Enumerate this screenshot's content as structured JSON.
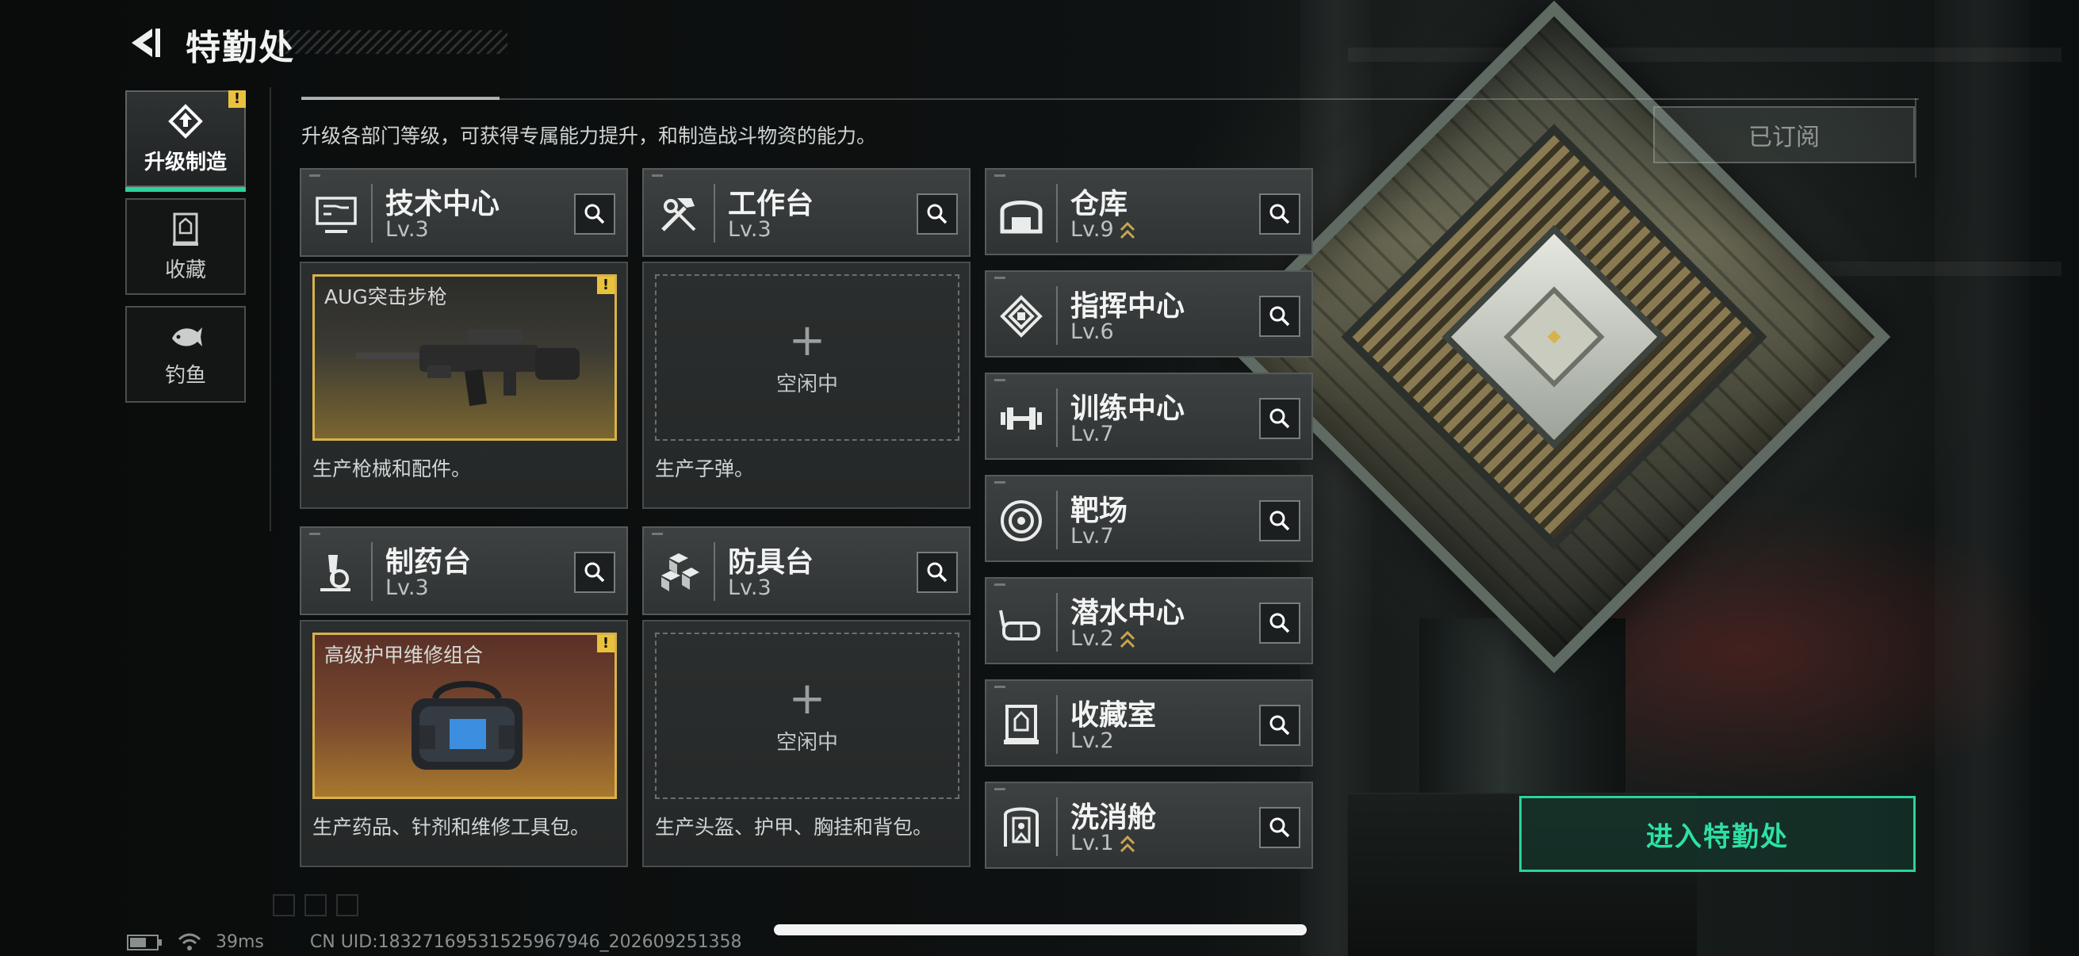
{
  "header": {
    "title": "特勤处"
  },
  "nav": [
    {
      "label": "升级制造",
      "icon": "upgrade-icon",
      "active": true,
      "badge": "!"
    },
    {
      "label": "收藏",
      "icon": "collection-icon",
      "active": false
    },
    {
      "label": "钓鱼",
      "icon": "fish-icon",
      "active": false
    }
  ],
  "description": "升级各部门等级，可获得专属能力提升，和制造战斗物资的能力。",
  "subscribed_label": "已订阅",
  "production_departments": [
    {
      "name": "技术中心",
      "level": "Lv.3",
      "icon": "monitor-icon",
      "slot": {
        "state": "producing",
        "item": "AUG突击步枪",
        "badge": "!"
      },
      "desc": "生产枪械和配件。"
    },
    {
      "name": "工作台",
      "level": "Lv.3",
      "icon": "hammer-wrench-icon",
      "slot": {
        "state": "idle",
        "idle_label": "空闲中"
      },
      "desc": "生产子弹。"
    },
    {
      "name": "制药台",
      "level": "Lv.3",
      "icon": "microscope-icon",
      "slot": {
        "state": "producing",
        "item": "高级护甲维修组合",
        "badge": "!"
      },
      "desc": "生产药品、针剂和维修工具包。"
    },
    {
      "name": "防具台",
      "level": "Lv.3",
      "icon": "blocks-icon",
      "slot": {
        "state": "idle",
        "idle_label": "空闲中"
      },
      "desc": "生产头盔、护甲、胸挂和背包。"
    }
  ],
  "other_departments": [
    {
      "name": "仓库",
      "level": "Lv.9",
      "upgradable": true,
      "icon": "warehouse-icon"
    },
    {
      "name": "指挥中心",
      "level": "Lv.6",
      "upgradable": false,
      "icon": "chip-icon"
    },
    {
      "name": "训练中心",
      "level": "Lv.7",
      "upgradable": false,
      "icon": "dumbbell-icon"
    },
    {
      "name": "靶场",
      "level": "Lv.7",
      "upgradable": false,
      "icon": "target-icon"
    },
    {
      "name": "潜水中心",
      "level": "Lv.2",
      "upgradable": true,
      "icon": "diving-mask-icon"
    },
    {
      "name": "收藏室",
      "level": "Lv.2",
      "upgradable": false,
      "icon": "display-case-icon"
    },
    {
      "name": "洗消舱",
      "level": "Lv.1",
      "upgradable": true,
      "icon": "decon-icon"
    }
  ],
  "enter_button": "进入特勤处",
  "footer": {
    "ping": "39ms",
    "uid": "CN UID:18327169531525967946_202609251358"
  },
  "colors": {
    "accent_green": "#2bd39a",
    "badge_yellow": "#e9c23d",
    "upgrade_gold": "#c8a550"
  }
}
